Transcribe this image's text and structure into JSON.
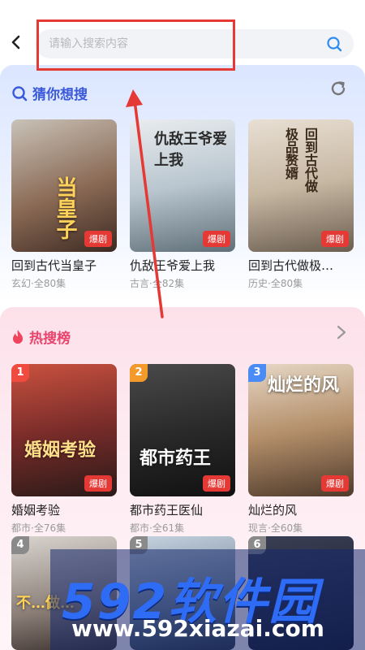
{
  "search": {
    "placeholder": "请输入搜索内容"
  },
  "guess": {
    "title": "猜你想搜",
    "items": [
      {
        "title": "回到古代当皇子",
        "meta": "玄幻·全80集",
        "badge": "爆剧",
        "poster_text": "当皇子"
      },
      {
        "title": "仇敌王爷爱上我",
        "meta": "古言·全82集",
        "badge": "爆剧",
        "poster_text": "仇敌王爷爱上我"
      },
      {
        "title": "回到古代做极…",
        "meta": "历史·全80集",
        "badge": "爆剧",
        "poster_text": "回到古代做极品赘婿"
      }
    ]
  },
  "hot": {
    "title": "热搜榜",
    "items": [
      {
        "rank": "1",
        "title": "婚姻考验",
        "meta": "都市·全76集",
        "badge": "爆剧",
        "poster_text": "婚姻考验"
      },
      {
        "rank": "2",
        "title": "都市药王医仙",
        "meta": "都市·全61集",
        "badge": "爆剧",
        "poster_text": "都市药王"
      },
      {
        "rank": "3",
        "title": "灿烂的风",
        "meta": "现言·全60集",
        "badge": "爆剧",
        "poster_text": "灿烂的风"
      }
    ],
    "next_ranks": [
      "4",
      "5",
      "6"
    ],
    "next_poster_text": "不…做…"
  },
  "watermark": {
    "brand": "592软件园",
    "url": "www.592xiazai.com"
  },
  "colors": {
    "accent_blue": "#3a5ad9",
    "accent_pink": "#e8446d",
    "badge_red": "#e53935"
  }
}
